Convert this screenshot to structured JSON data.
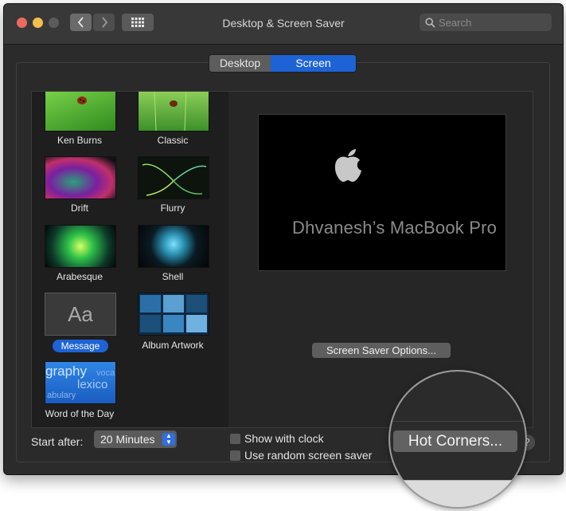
{
  "window": {
    "title": "Desktop & Screen Saver",
    "search_placeholder": "Search"
  },
  "tabs": [
    {
      "label": "Desktop",
      "selected": false
    },
    {
      "label": "Screen Saver",
      "selected": true
    }
  ],
  "savers": [
    {
      "label": "Ken Burns"
    },
    {
      "label": "Classic"
    },
    {
      "label": "Drift"
    },
    {
      "label": "Flurry"
    },
    {
      "label": "Arabesque"
    },
    {
      "label": "Shell"
    },
    {
      "label": "Message",
      "selected": true
    },
    {
      "label": "Album Artwork"
    },
    {
      "label": "Word of the Day"
    }
  ],
  "thumb_text": {
    "message_aa": "Aa",
    "word_graphy": "graphy",
    "word_vocab": "voca",
    "word_lexico": "lexico",
    "word_abulary": "abulary"
  },
  "preview": {
    "computer_name": "Dhvanesh’s MacBook Pro"
  },
  "options_button": "Screen Saver Options...",
  "start_after": {
    "label": "Start after:",
    "value": "20 Minutes"
  },
  "checkboxes": [
    {
      "label": "Show with clock",
      "checked": false
    },
    {
      "label": "Use random screen saver",
      "checked": false
    }
  ],
  "hot_corners_button": "Hot Corners...",
  "help": "?",
  "colors": {
    "accent": "#1d63d6",
    "window_bg": "#2b2b2b"
  }
}
